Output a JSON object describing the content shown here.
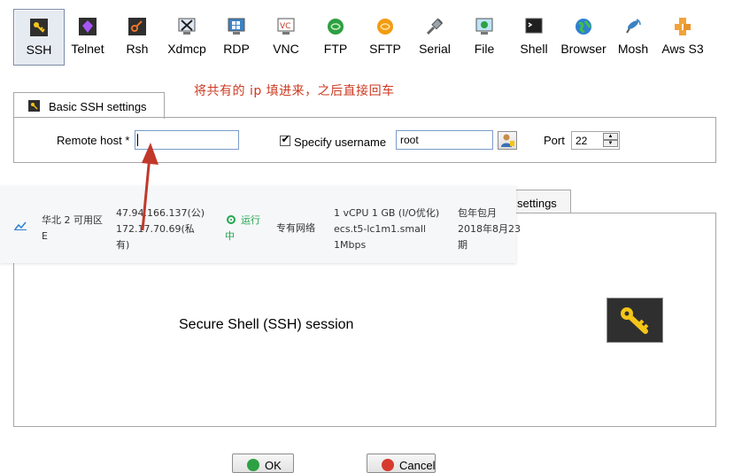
{
  "toolbar": {
    "items": [
      {
        "label": "SSH",
        "icon": "ssh-key-icon"
      },
      {
        "label": "Telnet",
        "icon": "telnet-icon"
      },
      {
        "label": "Rsh",
        "icon": "rsh-icon"
      },
      {
        "label": "Xdmcp",
        "icon": "xdmcp-icon"
      },
      {
        "label": "RDP",
        "icon": "rdp-icon"
      },
      {
        "label": "VNC",
        "icon": "vnc-icon"
      },
      {
        "label": "FTP",
        "icon": "ftp-icon"
      },
      {
        "label": "SFTP",
        "icon": "sftp-icon"
      },
      {
        "label": "Serial",
        "icon": "serial-icon"
      },
      {
        "label": "File",
        "icon": "file-icon"
      },
      {
        "label": "Shell",
        "icon": "shell-icon"
      },
      {
        "label": "Browser",
        "icon": "browser-icon"
      },
      {
        "label": "Mosh",
        "icon": "mosh-icon"
      },
      {
        "label": "Aws S3",
        "icon": "aws-s3-icon"
      }
    ]
  },
  "annotation": {
    "text": "将共有的 ip 填进来，之后直接回车",
    "color": "#cc3a21"
  },
  "basic_tab": {
    "label": "Basic SSH settings"
  },
  "form": {
    "remote_host_label": "Remote host *",
    "remote_host_value": "",
    "specify_username_label": "Specify username",
    "specify_username_checked": true,
    "username_value": "root",
    "port_label": "Port",
    "port_value": "22"
  },
  "advanced_tab": {
    "label": "settings"
  },
  "session": {
    "description": "Secure Shell (SSH) session"
  },
  "overlay": {
    "zone_line1": "华北 2 可用区",
    "zone_line2": "E",
    "public_ip": "47.94.166.137(公)",
    "private_ip_line1": "172.17.70.69(私",
    "private_ip_line2": "有)",
    "status_line1": "运行",
    "status_line2": "中",
    "network": "专有网络",
    "spec_line1": "1 vCPU 1 GB (I/O优化)",
    "spec_line2": "ecs.t5-lc1m1.small",
    "spec_line3": "1Mbps",
    "billing_line1": "包年包月",
    "billing_line2": "2018年8月23",
    "billing_line3": "期"
  },
  "buttons": {
    "ok": "OK",
    "cancel": "Cancel"
  }
}
